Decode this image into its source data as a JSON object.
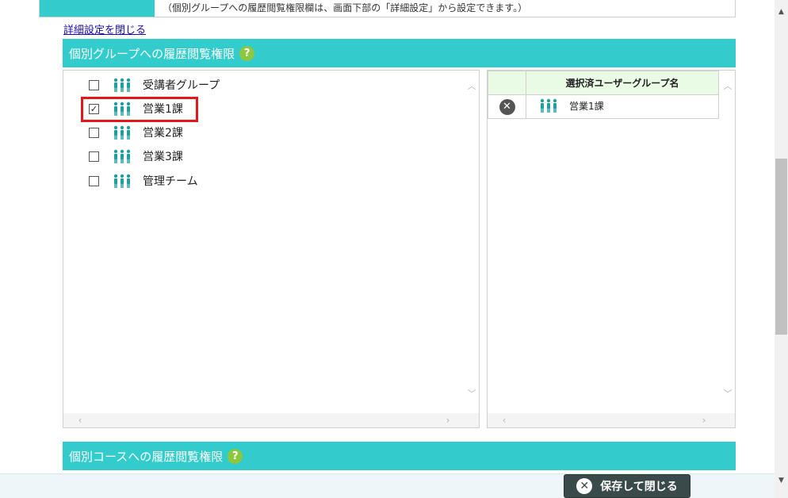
{
  "top_note": "（個別グループへの履歴閲覧権限欄は、画面下部の「詳細設定」から設定できます。）",
  "close_details_link": "詳細設定を閉じる",
  "group_section": {
    "title": "個別グループへの履歴閲覧権限",
    "help": "?",
    "groups": [
      {
        "label": "受講者グループ",
        "checked": false,
        "mark": ""
      },
      {
        "label": "営業1課",
        "checked": true,
        "mark": "✓"
      },
      {
        "label": "営業2課",
        "checked": false,
        "mark": ""
      },
      {
        "label": "営業3課",
        "checked": false,
        "mark": ""
      },
      {
        "label": "管理チーム",
        "checked": false,
        "mark": ""
      }
    ],
    "selected_header": "選択済ユーザーグループ名",
    "selected": [
      {
        "label": "営業1課",
        "remove": "✕"
      }
    ]
  },
  "course_section": {
    "title": "個別コースへの履歴閲覧権限",
    "help": "?"
  },
  "save_close_button": {
    "label": "保存して閉じる",
    "icon": "✕"
  },
  "colors": {
    "teal": "#33cccc",
    "help_green": "#8dc63f",
    "highlight_red": "#e01a1a",
    "icon_teal": "#1f9e9e"
  }
}
